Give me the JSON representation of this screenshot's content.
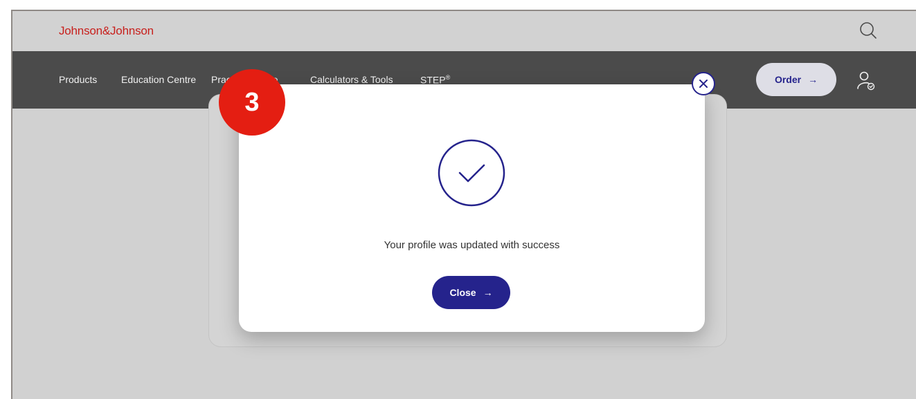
{
  "header": {
    "brand": "Johnson&Johnson"
  },
  "nav": {
    "items": [
      "Products",
      "Education Centre",
      "Practice Centre",
      "Calculators & Tools",
      "STEP"
    ],
    "step_sup": "®",
    "order_label": "Order",
    "order_arrow": "→"
  },
  "modal": {
    "message": "Your profile was updated with success",
    "close_label": "Close",
    "close_arrow": "→"
  },
  "annotation": {
    "step_number": "3"
  },
  "colors": {
    "brand_red": "#c8201d",
    "primary_blue": "#25238c",
    "badge_red": "#e41e12",
    "nav_dark": "#4b4b4b"
  },
  "icons": [
    "search-icon",
    "user-check-icon",
    "close-icon",
    "check-circle-icon",
    "arrow-right-icon"
  ]
}
